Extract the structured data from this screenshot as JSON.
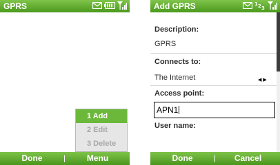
{
  "left_screen": {
    "title": "GPRS",
    "status_icons": [
      "envelope-icon",
      "battery-icon",
      "signal-icon"
    ],
    "menu": {
      "items": [
        {
          "label": "1 Add",
          "selected": true
        },
        {
          "label": "2 Edit",
          "selected": false
        },
        {
          "label": "3 Delete",
          "selected": false
        }
      ]
    },
    "softkeys": {
      "left": "Done",
      "right": "Menu"
    }
  },
  "right_screen": {
    "title": "Add GPRS",
    "input_mode_indicator": "123",
    "status_icons": [
      "envelope-icon",
      "input-mode-icon",
      "signal-icon"
    ],
    "form": {
      "description_label": "Description:",
      "description_value": "GPRS",
      "connects_to_label": "Connects to:",
      "connects_to_value": "The Internet",
      "access_point_label": "Access point:",
      "access_point_value": "APN1",
      "user_name_label": "User name:"
    },
    "softkeys": {
      "left": "Done",
      "right": "Cancel"
    }
  },
  "colors": {
    "accent_green": "#5aa92a",
    "menu_highlight": "#6cb83a",
    "menu_background": "#e6e6e6",
    "disabled_text": "#a8a8a8"
  }
}
